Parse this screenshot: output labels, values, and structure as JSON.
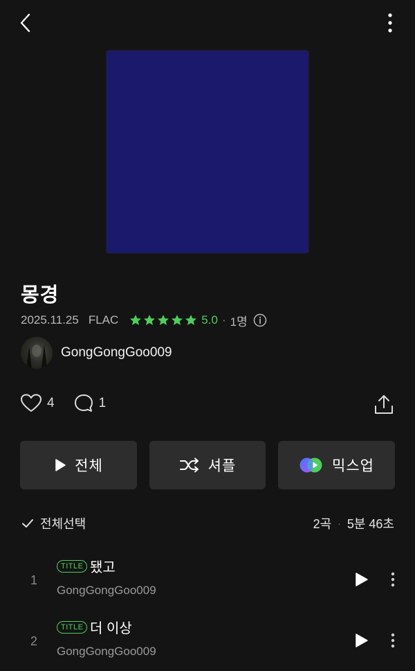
{
  "album": {
    "title": "몽경",
    "date": "2025.11.25",
    "format": "FLAC",
    "rating": "5.0",
    "rating_stars": 5,
    "rater_count": "1명",
    "cover_color": "#1a196b"
  },
  "artist": {
    "name": "GongGongGoo009"
  },
  "social": {
    "likes": "4",
    "comments": "1"
  },
  "actions": {
    "play_all": "전체",
    "shuffle": "셔플",
    "mixup": "믹스업"
  },
  "tracklist": {
    "select_all": "전체선택",
    "count": "2곡",
    "duration": "5분 46초",
    "tracks": [
      {
        "number": "1",
        "badge": "TITLE",
        "title": "됐고",
        "artist": "GongGongGoo009"
      },
      {
        "number": "2",
        "badge": "TITLE",
        "title": "더 이상",
        "artist": "GongGongGoo009"
      }
    ]
  },
  "colors": {
    "background": "#141414",
    "accent_green": "#4ccf5b",
    "button_bg": "#2d2d2d"
  },
  "icons": [
    "back-icon",
    "more-vertical-icon",
    "star-icon",
    "info-icon",
    "heart-icon",
    "comment-icon",
    "share-icon",
    "play-icon",
    "shuffle-icon",
    "mixup-icon",
    "check-icon"
  ]
}
